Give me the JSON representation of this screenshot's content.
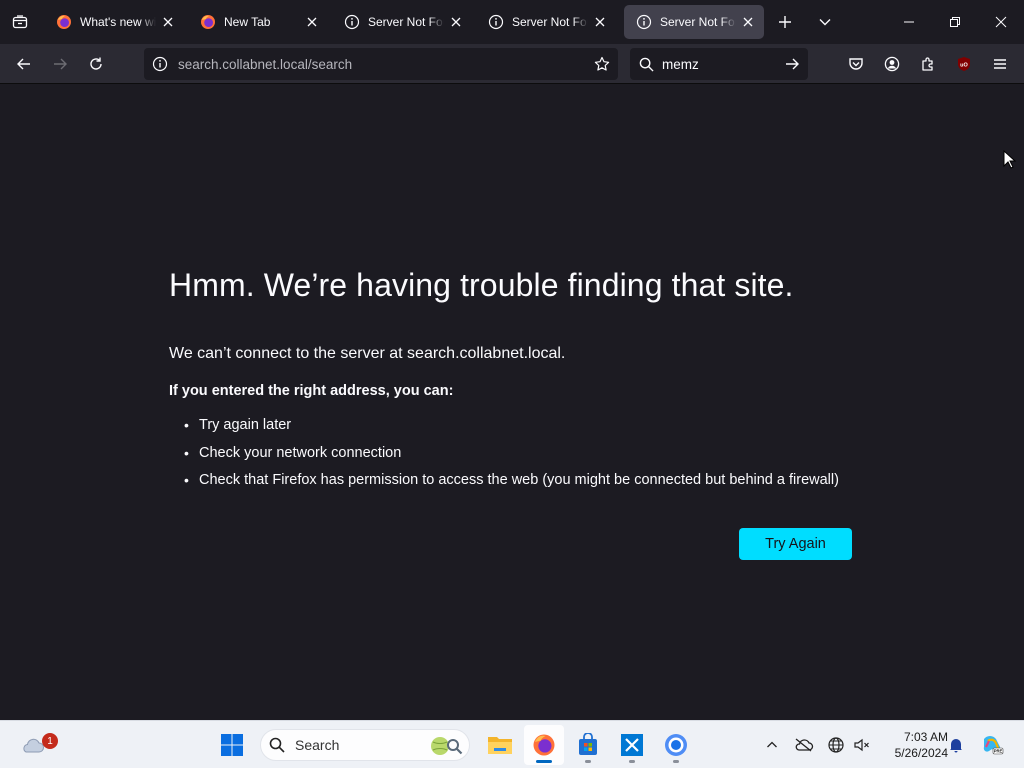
{
  "browser": {
    "tabs": [
      {
        "label": "What's new with",
        "icon": "firefox-icon",
        "active": false
      },
      {
        "label": "New Tab",
        "icon": "firefox-icon",
        "active": false
      },
      {
        "label": "Server Not Found",
        "icon": "info-icon",
        "active": false
      },
      {
        "label": "Server Not Found",
        "icon": "info-icon",
        "active": false
      },
      {
        "label": "Server Not Found",
        "icon": "info-icon",
        "active": true
      }
    ],
    "url": "search.collabnet.local/search",
    "search_value": "memz"
  },
  "error_page": {
    "title": "Hmm. We’re having trouble finding that site.",
    "lead": "We can’t connect to the server at search.collabnet.local.",
    "subheading": "If you entered the right address, you can:",
    "suggestions": [
      "Try again later",
      "Check your network connection",
      "Check that Firefox has permission to access the web (you might be connected but behind a firewall)"
    ],
    "try_again_label": "Try Again"
  },
  "taskbar": {
    "search_placeholder": "Search",
    "weather_badge": "1",
    "clock_time": "7:03 AM",
    "clock_date": "5/26/2024",
    "apps": [
      "windows-start-icon",
      "file-explorer-icon",
      "firefox-icon",
      "microsoft-store-icon",
      "vscode-icon",
      "chrome-icon"
    ]
  },
  "colors": {
    "accent": "#00ddff",
    "page_bg": "#1c1b22",
    "toolbar_bg": "#2b2a33",
    "active_tab": "#42414d"
  }
}
